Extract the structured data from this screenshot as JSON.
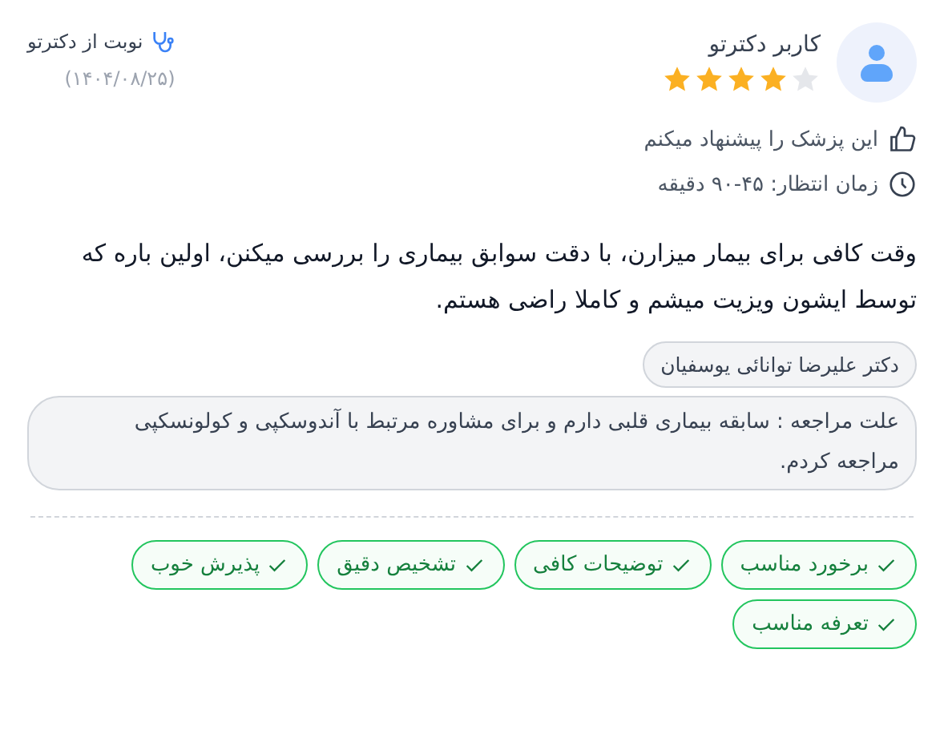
{
  "user": {
    "name": "کاربر دکترتو",
    "stars": 4
  },
  "source": {
    "label": "نوبت از دکترتو",
    "date": "(۱۴۰۴/۰۸/۲۵)"
  },
  "details": [
    {
      "kind": "recommend",
      "text": "این پزشک را پیشنهاد میکنم"
    },
    {
      "kind": "wait",
      "text": "زمان انتظار: ۴۵-۹۰ دقیقه"
    }
  ],
  "comment": "وقت کافی برای بیمار میزارن، با دقت سوابق بیماری را بررسی میکنن، اولین باره که توسط ایشون ویزیت میشم و کاملا راضی هستم.",
  "doctor": "دکتر علیرضا توانائی یوسفیان",
  "reason": "علت مراجعه : سابقه بیماری قلبی دارم و برای مشاوره مرتبط با آندوسکپی و کولونسکپی مراجعه کردم.",
  "tags": [
    "برخورد مناسب",
    "توضیحات کافی",
    "تشخیص دقیق",
    "پذیرش خوب",
    "تعرفه مناسب"
  ]
}
